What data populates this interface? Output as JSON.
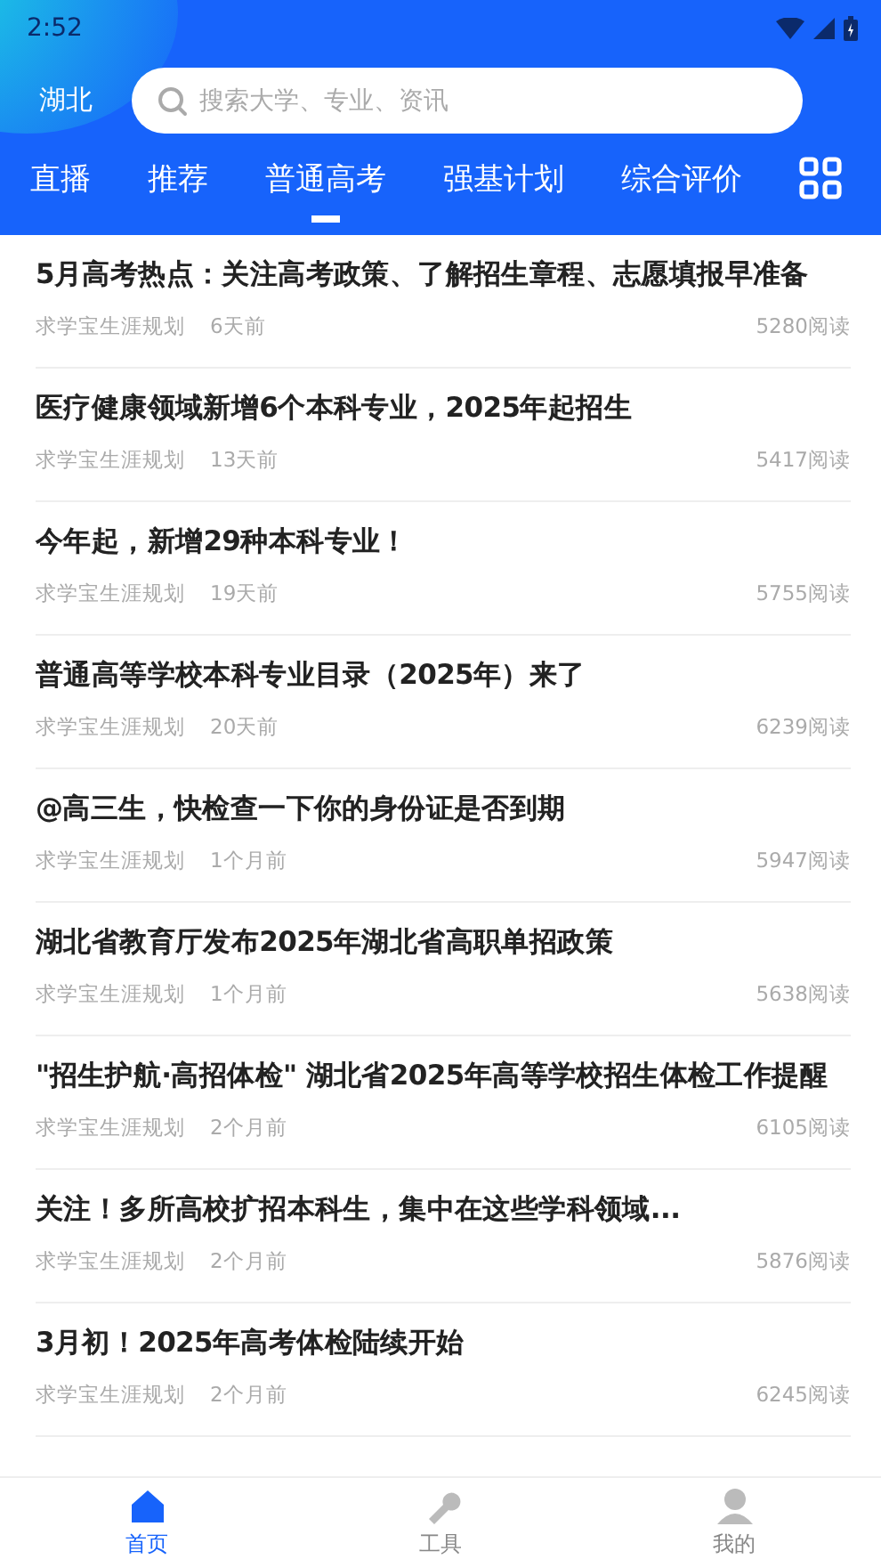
{
  "status_bar": {
    "time": "2:52"
  },
  "header": {
    "location": "湖北",
    "search": {
      "placeholder": "搜索大学、专业、资讯"
    }
  },
  "tabs": [
    {
      "label": "直播",
      "selected": false
    },
    {
      "label": "推荐",
      "selected": false
    },
    {
      "label": "普通高考",
      "selected": true
    },
    {
      "label": "强基计划",
      "selected": false
    },
    {
      "label": "综合评价",
      "selected": false
    }
  ],
  "articles": [
    {
      "title": "5月高考热点：关注高考政策、了解招生章程、志愿填报早准备",
      "source": "求学宝生涯规划",
      "time": "6天前",
      "reads": "5280阅读"
    },
    {
      "title": "医疗健康领域新增6个本科专业，2025年起招生",
      "source": "求学宝生涯规划",
      "time": "13天前",
      "reads": "5417阅读"
    },
    {
      "title": "今年起，新增29种本科专业！",
      "source": "求学宝生涯规划",
      "time": "19天前",
      "reads": "5755阅读"
    },
    {
      "title": "普通高等学校本科专业目录（2025年）来了",
      "source": "求学宝生涯规划",
      "time": "20天前",
      "reads": "6239阅读"
    },
    {
      "title": "@高三生，快检查一下你的身份证是否到期",
      "source": "求学宝生涯规划",
      "time": "1个月前",
      "reads": "5947阅读"
    },
    {
      "title": "湖北省教育厅发布2025年湖北省高职单招政策",
      "source": "求学宝生涯规划",
      "time": "1个月前",
      "reads": "5638阅读"
    },
    {
      "title": "\"招生护航·高招体检\" 湖北省2025年高等学校招生体检工作提醒",
      "source": "求学宝生涯规划",
      "time": "2个月前",
      "reads": "6105阅读"
    },
    {
      "title": "关注！多所高校扩招本科生，集中在这些学科领域...",
      "source": "求学宝生涯规划",
      "time": "2个月前",
      "reads": "5876阅读"
    },
    {
      "title": "3月初！2025年高考体检陆续开始",
      "source": "求学宝生涯规划",
      "time": "2个月前",
      "reads": "6245阅读"
    }
  ],
  "bottom_nav": [
    {
      "label": "首页",
      "kind": "home",
      "selected": true
    },
    {
      "label": "工具",
      "kind": "tools",
      "selected": false
    },
    {
      "label": "我的",
      "kind": "profile",
      "selected": false
    }
  ]
}
